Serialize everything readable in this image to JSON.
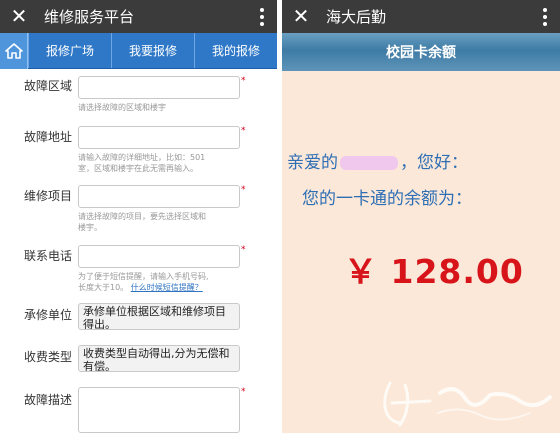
{
  "left": {
    "title": "维修服务平台",
    "nav": [
      "报修广场",
      "我要报修",
      "我的报修"
    ],
    "form": {
      "fault_area": {
        "label": "故障区域",
        "hint": "请选择故障的区域和楼宇"
      },
      "fault_address": {
        "label": "故障地址",
        "hint_line1": "请输入故障的详细地址，比如：501",
        "hint_line2": "室，区域和楼宇在此无需再输入。"
      },
      "repair_item": {
        "label": "维修项目",
        "hint_line1": "请选择故障的项目，要先选择区域和",
        "hint_line2": "楼宇。"
      },
      "phone": {
        "label": "联系电话",
        "hint_line1": "为了便于短信提醒，请输入手机号码,",
        "hint_line2_prefix": "长度大于10。",
        "hint_link": "什么时候短信提醒？"
      },
      "contractor": {
        "label": "承修单位",
        "value": "承修单位根据区域和维修项目得出。"
      },
      "fee_type": {
        "label": "收费类型",
        "value": "收费类型自动得出,分为无偿和有偿。"
      },
      "description": {
        "label": "故障描述"
      },
      "required_mark": "*"
    }
  },
  "right": {
    "title": "海大后勤",
    "banner": "校园卡余额",
    "greeting_prefix": "亲爱的",
    "greeting_suffix": "，您好：",
    "balance_line": "您的一卡通的余额为：",
    "amount": "￥ 128.00"
  },
  "colors": {
    "titlebar": "#3b3b3b",
    "nav_blue": "#2f78c7",
    "required_red": "#d0021b",
    "greeting_blue": "#2e6eb5",
    "amount_red": "#d8141b",
    "right_bg": "#fbe8d8"
  },
  "icons": {
    "close": "x-icon",
    "menu": "more-vertical-icon",
    "home": "home-icon"
  }
}
